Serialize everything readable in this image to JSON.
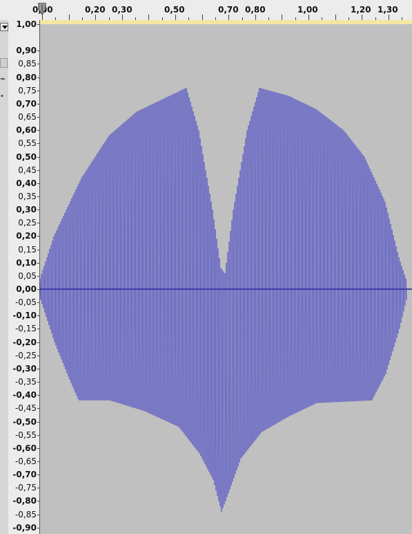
{
  "ruler": {
    "labels": [
      "0,00",
      "0,20",
      "0,30",
      "0,50",
      "0,70",
      "0,80",
      "1,00",
      "1,20",
      "1,30"
    ]
  },
  "vertical_ruler": {
    "labels": [
      "1,00",
      "0,90",
      "0,85",
      "0,80",
      "0,75",
      "0,70",
      "0,65",
      "0,60",
      "0,55",
      "0,50",
      "0,45",
      "0,40",
      "0,35",
      "0,30",
      "0,25",
      "0,20",
      "0,15",
      "0,10",
      "0,05",
      "0,00",
      "-0,05",
      "-0,10",
      "-0,15",
      "-0,20",
      "-0,25",
      "-0,30",
      "-0,35",
      "-0,40",
      "-0,45",
      "-0,50",
      "-0,55",
      "-0,60",
      "-0,65",
      "-0,70",
      "-0,75",
      "-0,80",
      "-0,85",
      "-0,90"
    ]
  },
  "colors": {
    "waveform": "#3232c8",
    "background": "#c0c0c0",
    "ruler_bg": "#ececec",
    "selection": "#f5e7a0"
  },
  "icons": {
    "track_menu": "dropdown-arrow-icon",
    "play_head": "play-head-icon"
  }
}
